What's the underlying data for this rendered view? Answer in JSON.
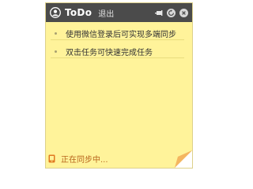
{
  "titlebar": {
    "app_title": "ToDo",
    "logout_label": "退出",
    "icons": [
      "user-icon",
      "pin-icon",
      "refresh-icon",
      "close-icon"
    ]
  },
  "tasks": [
    {
      "text": "使用微信登录后可实现多端同步"
    },
    {
      "text": "双击任务可快速完成任务"
    }
  ],
  "status": {
    "sync_text": "正在同步中...",
    "icon": "phone-icon"
  },
  "colors": {
    "note_background": "#fff39a",
    "titlebar": "#4b4b4b",
    "sync_text": "#b8651c",
    "page_curl": "#f0a646"
  }
}
